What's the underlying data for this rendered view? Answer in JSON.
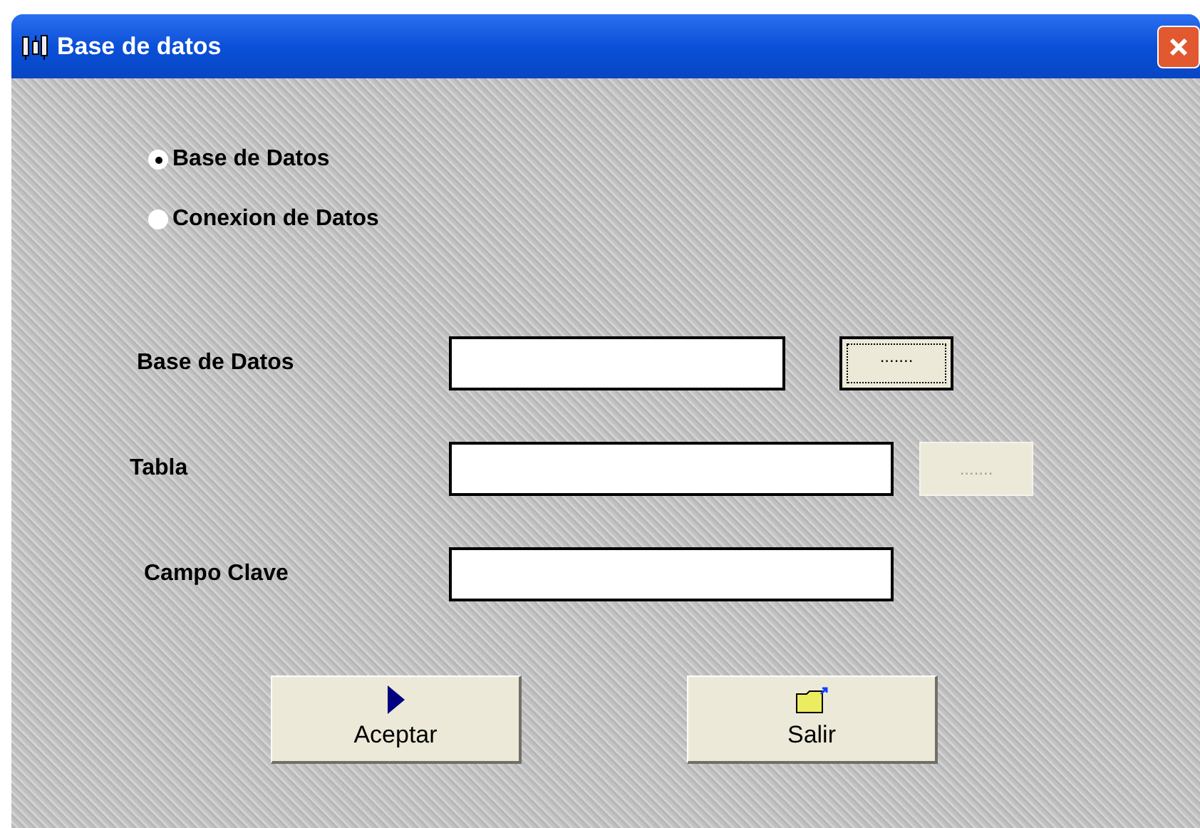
{
  "window": {
    "title": "Base de datos"
  },
  "options": [
    {
      "label": "Base de Datos",
      "selected": true
    },
    {
      "label": "Conexion de Datos",
      "selected": false
    }
  ],
  "fields": [
    {
      "label": "Base de Datos",
      "browse": {
        "label": ".......",
        "disabled": false
      }
    },
    {
      "label": "Tabla",
      "browse": {
        "label": ".......",
        "disabled": true
      }
    },
    {
      "label": "Campo Clave"
    }
  ],
  "buttons": [
    {
      "kind": "accept",
      "label": "Aceptar"
    },
    {
      "kind": "exit",
      "label": "Salir"
    }
  ]
}
